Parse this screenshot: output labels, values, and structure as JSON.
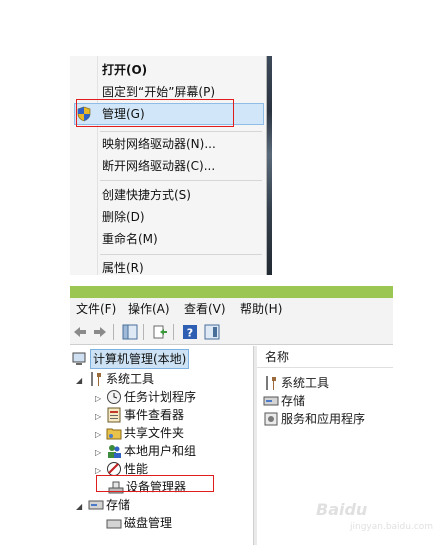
{
  "context_menu": {
    "items": [
      {
        "label": "打开(O)",
        "bold": true
      },
      {
        "label": "固定到“开始”屏幕(P)"
      },
      {
        "label": "管理(G)",
        "highlighted": true,
        "icon": "uac-shield-icon"
      },
      {
        "label": "映射网络驱动器(N)..."
      },
      {
        "label": "断开网络驱动器(C)..."
      },
      {
        "label": "创建快捷方式(S)"
      },
      {
        "label": "删除(D)"
      },
      {
        "label": "重命名(M)"
      },
      {
        "label": "属性(R)"
      }
    ]
  },
  "computer_management": {
    "menubar": [
      "文件(F)",
      "操作(A)",
      "查看(V)",
      "帮助(H)"
    ],
    "toolbar_icons": [
      "back-arrow-icon",
      "forward-arrow-icon",
      "show-hide-tree-icon",
      "export-list-icon",
      "help-icon",
      "properties-icon"
    ],
    "tree": {
      "root": "计算机管理(本地)",
      "system_tools": "系统工具",
      "children": [
        "任务计划程序",
        "事件查看器",
        "共享文件夹",
        "本地用户和组",
        "性能",
        "设备管理器"
      ],
      "storage": "存储",
      "storage_child": "磁盘管理"
    },
    "right_pane": {
      "column_header": "名称",
      "items": [
        "系统工具",
        "存储",
        "服务和应用程序"
      ]
    }
  },
  "watermark": {
    "brand": "Baidu",
    "sub": "jingyan.baidu.com"
  },
  "colors": {
    "highlight": "#d1e6f8",
    "redbox": "#e01c1c",
    "titlebar": "#9bc654"
  }
}
